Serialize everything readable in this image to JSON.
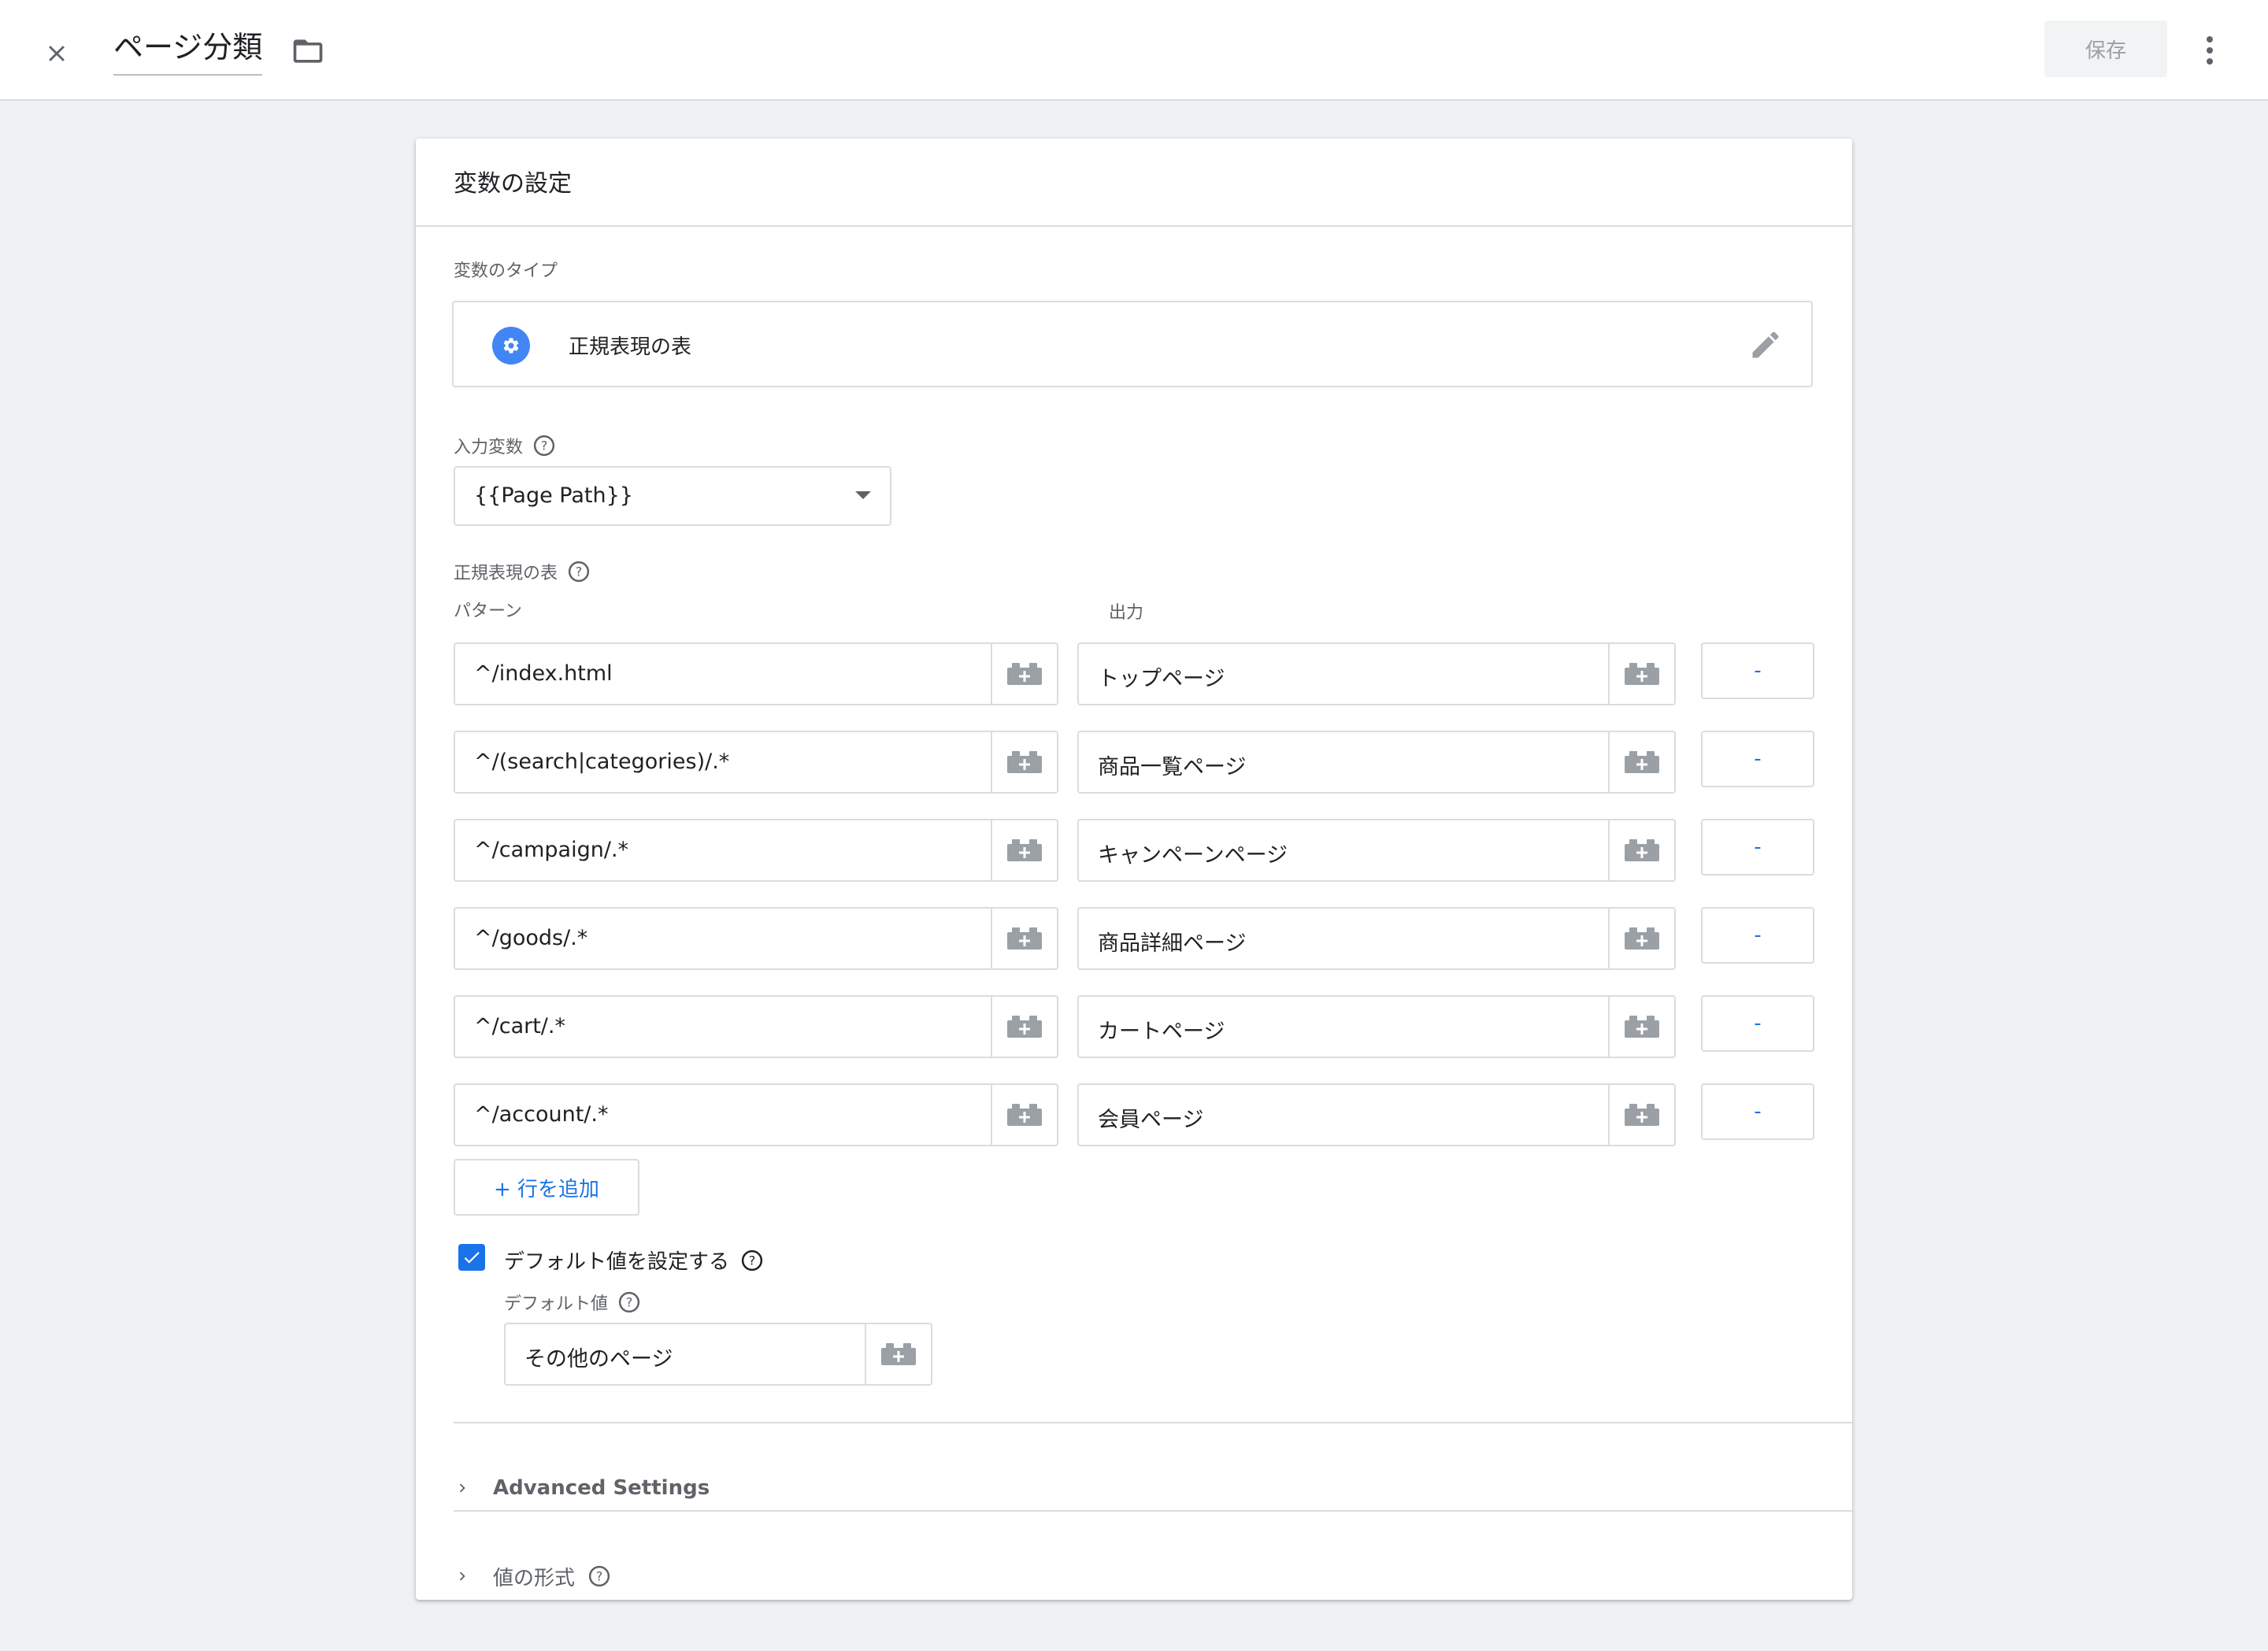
{
  "header": {
    "title": "ページ分類",
    "save_label": "保存"
  },
  "card": {
    "title": "変数の設定",
    "variable_type_label": "変数のタイプ",
    "variable_type_value": "正規表現の表",
    "input_variable_label": "入力変数",
    "input_variable_value": "{{Page Path}}",
    "regex_table_label": "正規表現の表",
    "pattern_header": "パターン",
    "output_header": "出力",
    "rows": [
      {
        "pattern": "^/index.html",
        "output": "トップページ",
        "remove": "-"
      },
      {
        "pattern": "^/(search|categories)/.*",
        "output": "商品一覧ページ",
        "remove": "-"
      },
      {
        "pattern": "^/campaign/.*",
        "output": "キャンペーンページ",
        "remove": "-"
      },
      {
        "pattern": "^/goods/.*",
        "output": "商品詳細ページ",
        "remove": "-"
      },
      {
        "pattern": "^/cart/.*",
        "output": "カートページ",
        "remove": "-"
      },
      {
        "pattern": "^/account/.*",
        "output": "会員ページ",
        "remove": "-"
      }
    ],
    "add_row_label": "+ 行を追加",
    "default_checkbox_label": "デフォルト値を設定する",
    "default_checked": true,
    "default_value_label": "デフォルト値",
    "default_value": "その他のページ",
    "advanced_settings_label": "Advanced Settings",
    "value_format_label": "値の形式"
  },
  "colors": {
    "accent": "#1a73e8",
    "background": "#eff1f3",
    "border": "#dadce0"
  }
}
